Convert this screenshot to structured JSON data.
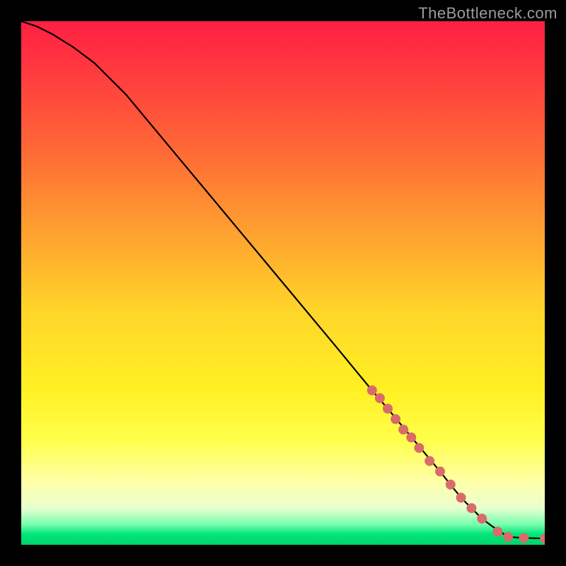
{
  "watermark": "TheBottleneck.com",
  "chart_data": {
    "type": "line",
    "title": "",
    "xlabel": "",
    "ylabel": "",
    "xlim": [
      0,
      100
    ],
    "ylim": [
      0,
      100
    ],
    "axes_visible": false,
    "background": "rainbow-vertical-gradient",
    "series": [
      {
        "name": "curve",
        "stroke": "#000000",
        "x": [
          0,
          3,
          6,
          10,
          14,
          20,
          30,
          40,
          50,
          60,
          67,
          70,
          75,
          80,
          84,
          86,
          88,
          90,
          93,
          96,
          100
        ],
        "y": [
          100,
          99,
          97.5,
          95,
          92,
          86,
          74,
          62,
          50,
          38,
          29.5,
          26,
          20,
          14,
          9,
          7,
          5,
          3.5,
          1.5,
          1.3,
          1.2
        ]
      }
    ],
    "markers": {
      "name": "highlighted-points",
      "color": "#d96b6b",
      "radius": 7,
      "points": [
        {
          "x": 67,
          "y": 29.5
        },
        {
          "x": 68.5,
          "y": 28
        },
        {
          "x": 70,
          "y": 26
        },
        {
          "x": 71.5,
          "y": 24
        },
        {
          "x": 73,
          "y": 22
        },
        {
          "x": 74.5,
          "y": 20.5
        },
        {
          "x": 76,
          "y": 18.5
        },
        {
          "x": 78,
          "y": 16
        },
        {
          "x": 80,
          "y": 14
        },
        {
          "x": 82,
          "y": 11.5
        },
        {
          "x": 84,
          "y": 9
        },
        {
          "x": 86,
          "y": 7
        },
        {
          "x": 88,
          "y": 5
        },
        {
          "x": 91,
          "y": 2.5
        },
        {
          "x": 93,
          "y": 1.5
        },
        {
          "x": 96,
          "y": 1.3
        },
        {
          "x": 100,
          "y": 1.2
        }
      ]
    }
  }
}
